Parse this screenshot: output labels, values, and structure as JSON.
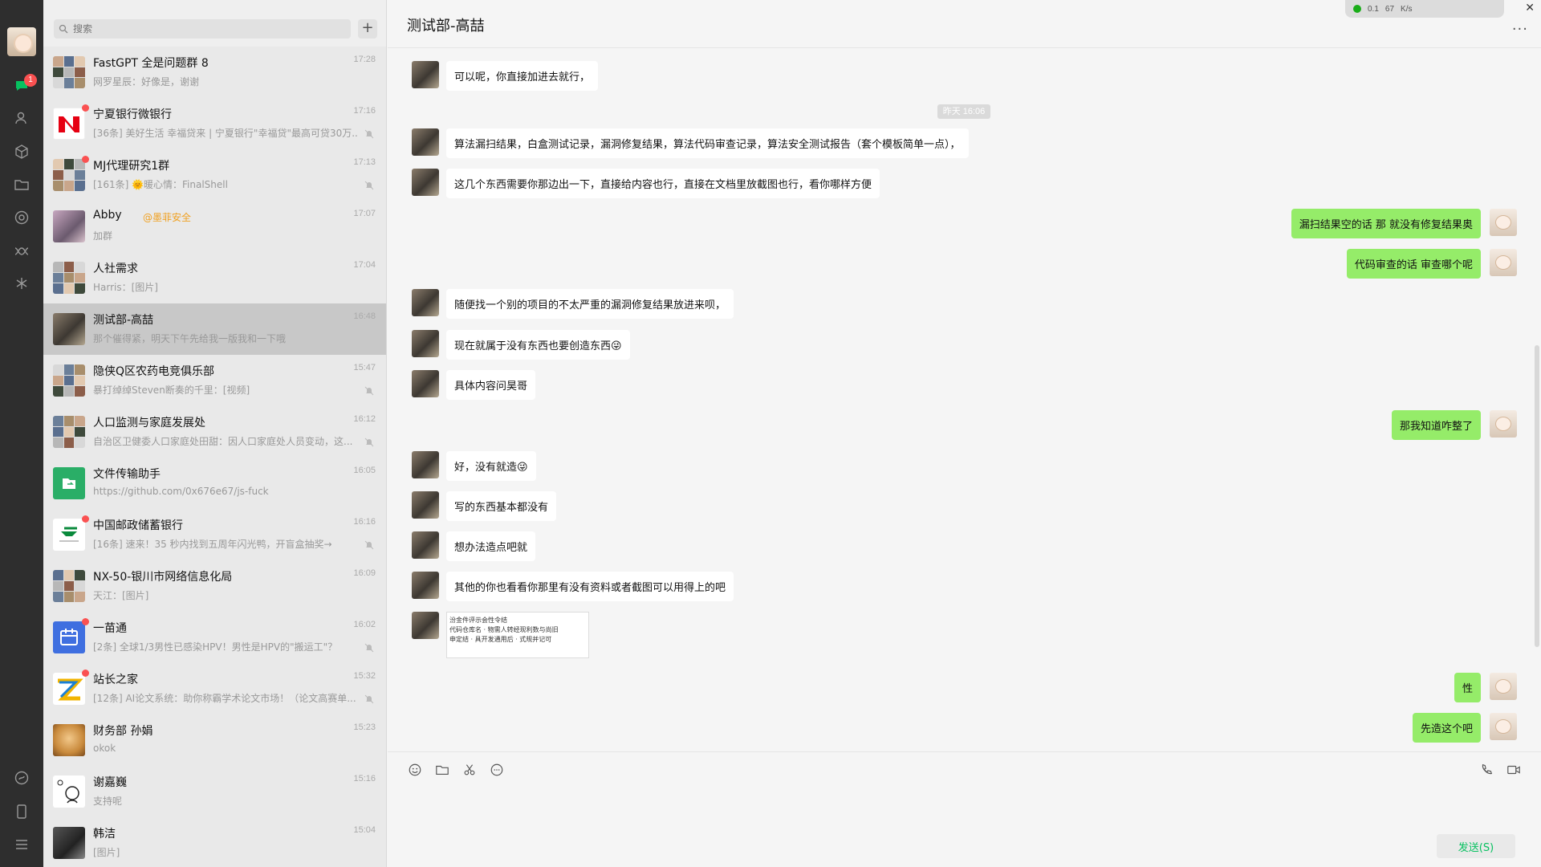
{
  "search": {
    "placeholder": "搜索"
  },
  "nav": {
    "unread_badge": "1"
  },
  "chats": [
    {
      "name": "FastGPT 全是问题群 8",
      "time": "17:28",
      "preview": "网罗星辰：好像是，谢谢",
      "muted": false,
      "unread": false
    },
    {
      "name": "宁夏银行微银行",
      "time": "17:16",
      "preview": "[36条] 美好生活 幸福贷来 | 宁夏银行\"幸福贷\"最高可贷30万...",
      "muted": true,
      "unread": true
    },
    {
      "name": "MJ代理研究1群",
      "time": "17:13",
      "preview": "[161条] 🌞暖心情：FinalShell",
      "muted": true,
      "unread": true
    },
    {
      "name": "Abby",
      "name_tag": "@墨菲安全",
      "time": "17:07",
      "preview": "加群",
      "muted": false,
      "unread": false
    },
    {
      "name": "人社需求",
      "time": "17:04",
      "preview": "Harris：[图片]",
      "muted": false,
      "unread": false
    },
    {
      "name": "测试部-高喆",
      "time": "16:48",
      "preview": "那个催得紧，明天下午先给我一版我和一下哦",
      "muted": false,
      "unread": false,
      "selected": true
    },
    {
      "name": "隐侠Q区农药电竞俱乐部",
      "time": "15:47",
      "preview": "暴打绰绰Steven断奏的千里：[视频]",
      "muted": true,
      "unread": false
    },
    {
      "name": "人口监测与家庭发展处",
      "time": "16:12",
      "preview": "自治区卫健委人口家庭处田甜：因人口家庭处人员变动，这...",
      "muted": true,
      "unread": false
    },
    {
      "name": "文件传输助手",
      "time": "16:05",
      "preview": "https://github.com/0x676e67/js-fuck",
      "muted": false,
      "unread": false
    },
    {
      "name": "中国邮政储蓄银行",
      "time": "16:16",
      "preview": "[16条] 速来！35 秒内找到五周年闪光鸭，开盲盒抽奖→",
      "muted": true,
      "unread": true
    },
    {
      "name": "NX-50-银川市网络信息化局",
      "time": "16:09",
      "preview": "天江：[图片]",
      "muted": false,
      "unread": false
    },
    {
      "name": "一苗通",
      "time": "16:02",
      "preview": "[2条] 全球1/3男性已感染HPV！男性是HPV的\"搬运工\"？",
      "muted": true,
      "unread": true
    },
    {
      "name": "站长之家",
      "time": "15:32",
      "preview": "[12条] AI论文系统：助你称霸学术论文市场！（论文高赛单...",
      "muted": true,
      "unread": true
    },
    {
      "name": "财务部 孙娟",
      "time": "15:23",
      "preview": "okok",
      "muted": false,
      "unread": false
    },
    {
      "name": "谢嘉巍",
      "time": "15:16",
      "preview": "支持呢",
      "muted": false,
      "unread": false
    },
    {
      "name": "韩洁",
      "time": "15:04",
      "preview": "[图片]",
      "muted": false,
      "unread": false
    }
  ],
  "conversation": {
    "title": "测试部-高喆",
    "net_widget": {
      "up": "0.1",
      "down": "67",
      "unit": "K/s"
    },
    "time_separator": "昨天 16:06",
    "messages": [
      {
        "side": "left",
        "text": "可以呢，你直接加进去就行，"
      },
      {
        "side": "left",
        "text": "算法漏扫结果，白盒测试记录，漏洞修复结果，算法代码审查记录，算法安全测试报告（套个模板简单一点），"
      },
      {
        "side": "left",
        "text": "这几个东西需要你那边出一下，直接给内容也行，直接在文档里放截图也行，看你哪样方便"
      },
      {
        "side": "right",
        "text": "漏扫结果空的话 那 就没有修复结果奥"
      },
      {
        "side": "right",
        "text": "代码审查的话 审查哪个呢"
      },
      {
        "side": "left",
        "text": "随便找一个别的项目的不太严重的漏洞修复结果放进来呗，"
      },
      {
        "side": "left",
        "text": "现在就属于没有东西也要创造东西😜"
      },
      {
        "side": "left",
        "text": "具体内容问昊哥"
      },
      {
        "side": "right",
        "text": "那我知道咋整了"
      },
      {
        "side": "left",
        "text": "好，没有就造😜"
      },
      {
        "side": "left",
        "text": "写的东西基本都没有"
      },
      {
        "side": "left",
        "text": "想办法造点吧就"
      },
      {
        "side": "left",
        "text": "其他的你也看看你那里有没有资料或者截图可以用得上的吧"
      },
      {
        "side": "right",
        "text": "性"
      },
      {
        "side": "right",
        "text": "先造这个吧"
      }
    ],
    "image_message_lines": [
      "汾金件评示会性令结",
      "代码仓库名 · 物需人转经现利数与尚旧",
      "申定结 · 具开发通用后 · 式规并记可"
    ]
  },
  "input": {
    "send_label": "发送(S)"
  },
  "colors": {
    "accent": "#07c160",
    "bubble_me": "#95ec69",
    "rail_bg": "#2e2e2e",
    "badge": "#fa5151"
  }
}
